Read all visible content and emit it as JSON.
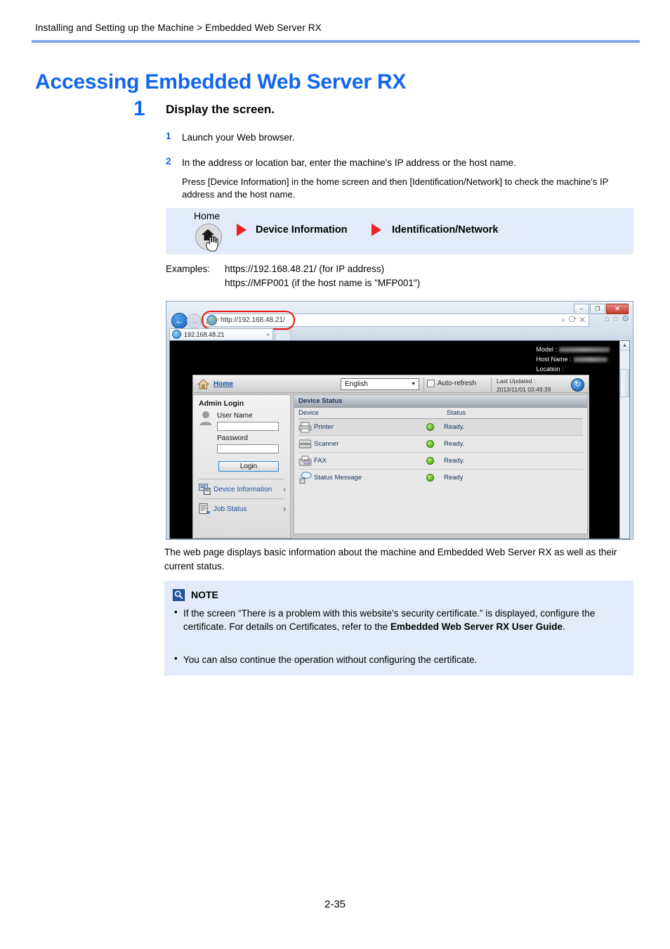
{
  "header": {
    "breadcrumb": "Installing and Setting up the Machine > Embedded Web Server RX",
    "title": "Accessing Embedded Web Server RX"
  },
  "step": {
    "number": "1",
    "title": "Display the screen.",
    "substeps": [
      {
        "number": "1",
        "text": "Launch your Web browser."
      },
      {
        "number": "2",
        "text": "In the address or location bar, enter the machine's IP address or the host name."
      }
    ],
    "note_paragraph": "Press [Device Information] in the home screen and then [Identification/Network] to check the machine's IP address and the host name."
  },
  "path_box": {
    "home_label": "Home",
    "home_icon": "home-house-icon",
    "hand_icon": "hand-pointer-icon",
    "arrow_icon": "right-arrow-icon",
    "steps": [
      "Device Information",
      "Identification/Network"
    ],
    "background": "#e3ebfa",
    "arrow_color": "#ee2222"
  },
  "examples": {
    "label": "Examples:",
    "lines": [
      "https://192.168.48.21/ (for IP address)",
      "https://MFP001 (if the host name is \"MFP001\")"
    ]
  },
  "browser": {
    "window_controls": {
      "minimize": "–",
      "maximize": "❐",
      "close": "✕"
    },
    "back_icon": "back-arrow-icon",
    "forward_icon": "forward-arrow-icon",
    "ie_icon": "internet-explorer-icon",
    "url": "http://192.168.48.21/",
    "url_right_icons": "⌕ ⟳ ✕",
    "tool_icons": "⌂ ☆ ⚙",
    "tab_title": "192.168.48.21",
    "tab_close": "×",
    "device_header": {
      "model_label": "Model :",
      "host_label": "Host Name :",
      "location_label": "Location :"
    },
    "app": {
      "home_link": "Home",
      "home_icon": "house-icon",
      "language": "English",
      "language_caret": "▼",
      "auto_refresh": "Auto-refresh",
      "last_updated_label": "Last Updated :",
      "last_updated_value": "2013/11/01 03:49:39",
      "refresh_icon": "refresh-icon",
      "admin_login": {
        "title": "Admin Login",
        "avatar_icon": "user-avatar-icon",
        "user_name_label": "User Name",
        "user_name_value": "",
        "password_label": "Password",
        "password_value": "",
        "login_button": "Login"
      },
      "menu": [
        {
          "label": "Device Information",
          "icon": "device-information-icon",
          "caret": "›"
        },
        {
          "label": "Job Status",
          "icon": "job-status-icon",
          "caret": "›"
        }
      ],
      "device_status": {
        "panel_title": "Device Status",
        "columns": [
          "Device",
          "Status"
        ],
        "rows": [
          {
            "device": "Printer",
            "icon": "printer-icon",
            "led": "green",
            "status": "Ready."
          },
          {
            "device": "Scanner",
            "icon": "scanner-icon",
            "led": "green",
            "status": "Ready."
          },
          {
            "device": "FAX",
            "icon": "fax-icon",
            "led": "green",
            "status": "Ready."
          },
          {
            "device": "Status Message",
            "icon": "status-message-icon",
            "led": "green",
            "status": "Ready"
          }
        ]
      }
    }
  },
  "caption": "The web page displays basic information about the machine and Embedded Web Server RX as well as their current status.",
  "note": {
    "icon": "note-magnifier-icon",
    "title": "NOTE",
    "bullet": "•",
    "items": [
      {
        "text_before": "If the screen “There is a problem with this website's security certificate.” is displayed, configure the certificate. For details on Certificates, refer to the ",
        "bold": "Embedded Web Server RX User Guide",
        "text_after": "."
      },
      {
        "text_before": "You can also continue the operation without configuring the certificate.",
        "bold": "",
        "text_after": ""
      }
    ],
    "background": "#e3ebfa"
  },
  "footer": {
    "page_number": "2-35"
  }
}
